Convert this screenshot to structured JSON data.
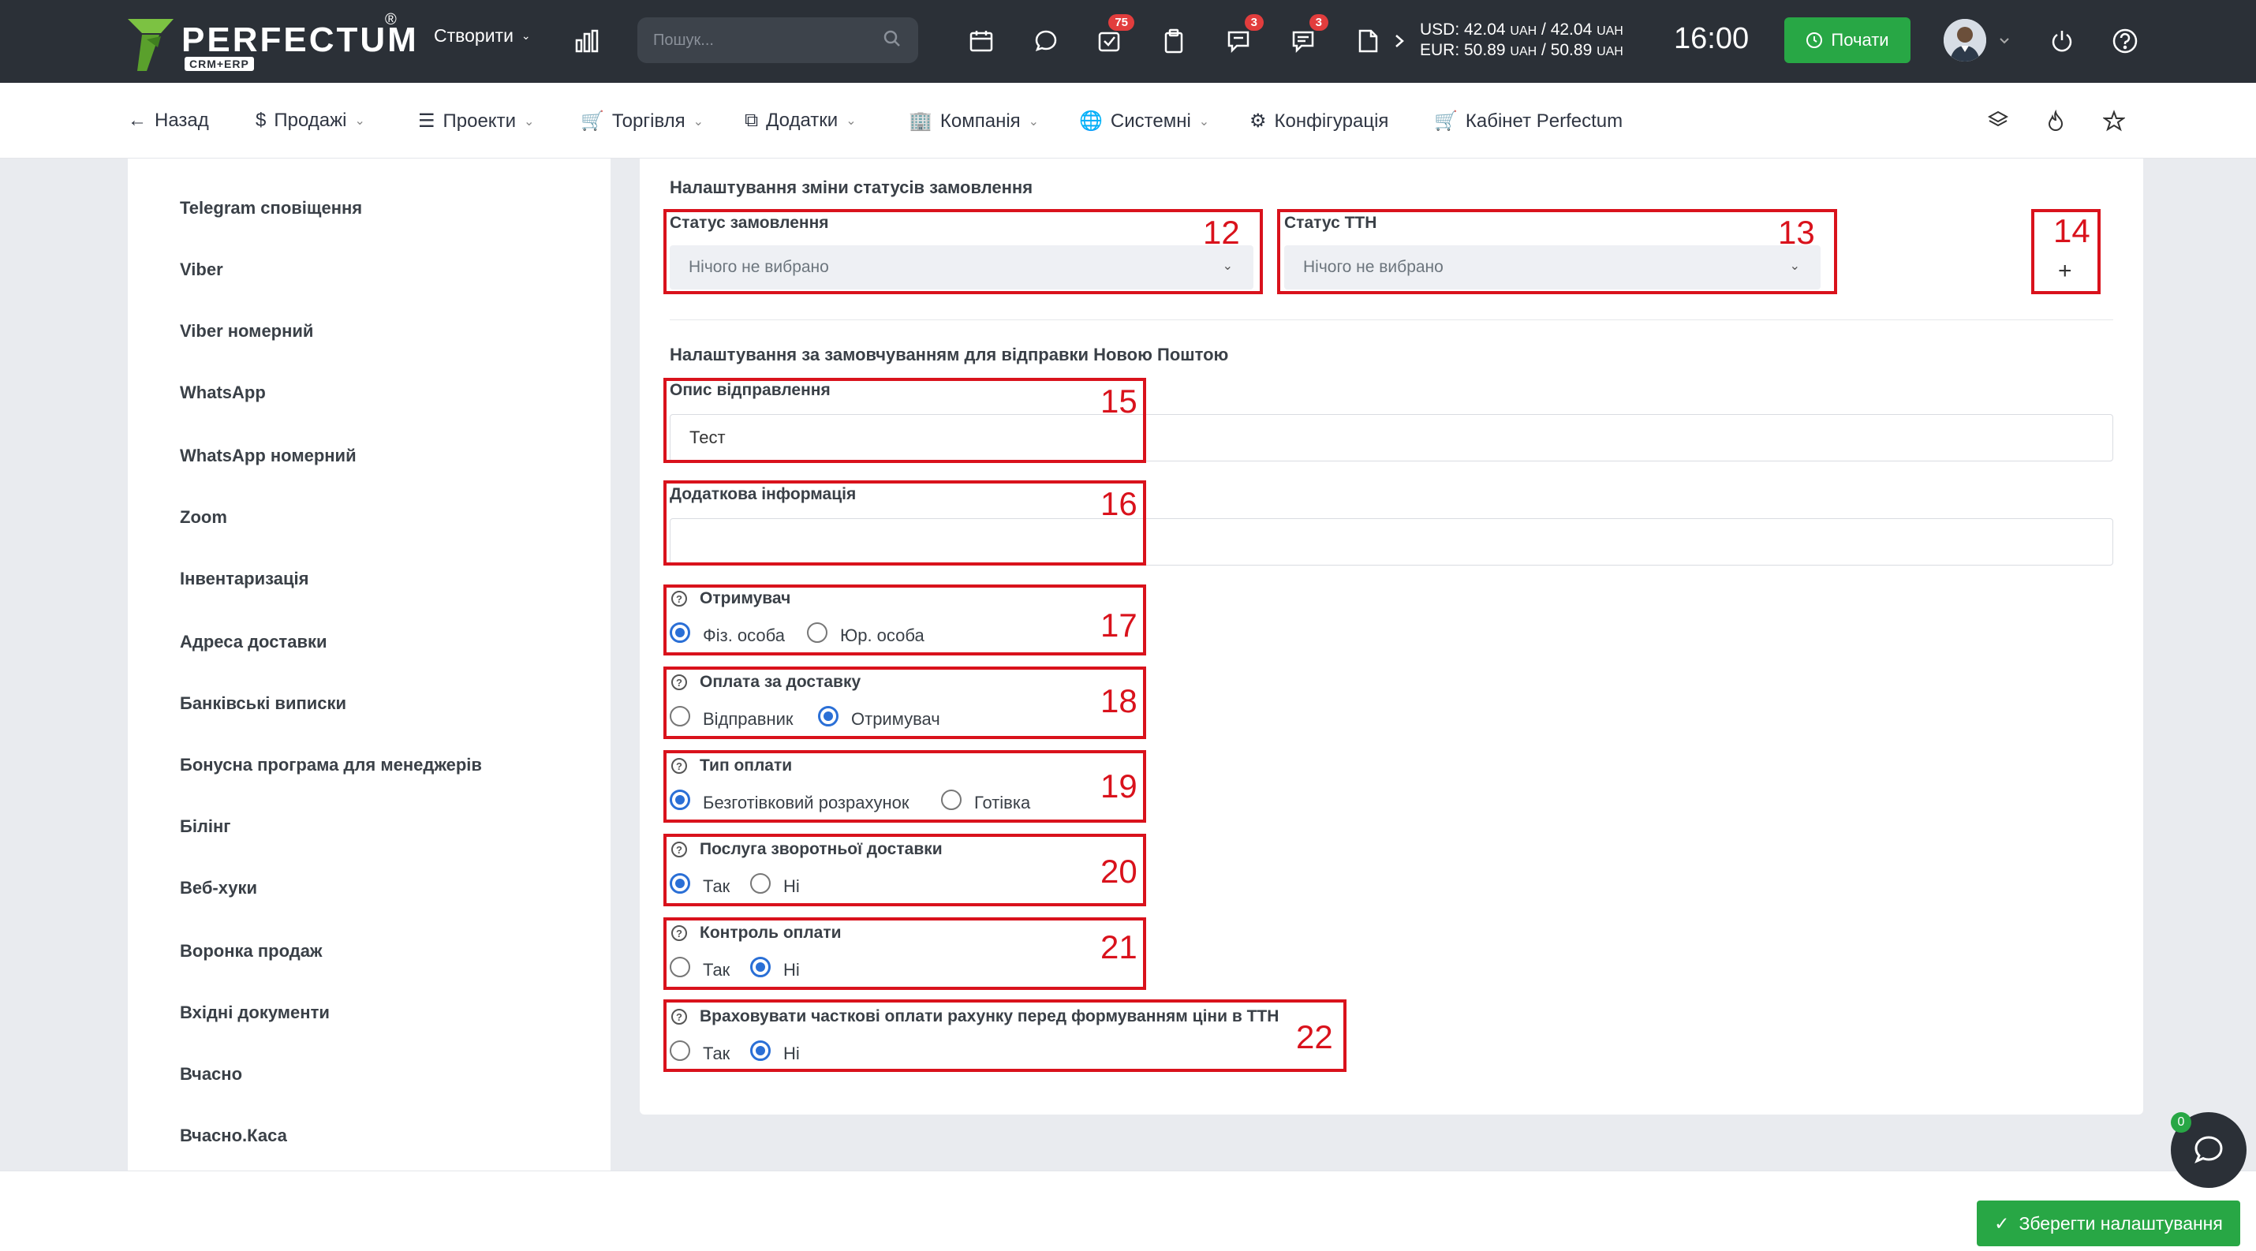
{
  "brand": {
    "name": "PERFECTUM",
    "sub": "CRM+ERP",
    "reg": "®"
  },
  "topbar": {
    "create_label": "Створити",
    "search_placeholder": "Пошук...",
    "badges": {
      "tasks": "75",
      "messages": "3",
      "chat": "3"
    },
    "rates": {
      "usd_line": "USD: 42.04",
      "usd_unit1": "UAH",
      "usd_sep": " / 42.04 ",
      "usd_unit2": "UAH",
      "eur_line": "EUR: 50.89",
      "eur_unit1": "UAH",
      "eur_sep": " / 50.89 ",
      "eur_unit2": "UAH"
    },
    "time": "16:00",
    "start_label": "Почати"
  },
  "nav": {
    "back": "Назад",
    "sales": "Продажі",
    "projects": "Проекти",
    "trade": "Торгівля",
    "addons": "Додатки",
    "company": "Компанія",
    "system": "Системні",
    "config": "Конфігурація",
    "cabinet": "Кабінет Perfectum"
  },
  "sidebar": {
    "items": [
      "Telegram сповіщення",
      "Viber",
      "Viber номерний",
      "WhatsApp",
      "WhatsApp номерний",
      "Zoom",
      "Інвентаризація",
      "Адреса доставки",
      "Банківські виписки",
      "Бонусна програма для менеджерів",
      "Білінг",
      "Веб-хуки",
      "Воронка продаж",
      "Вхідні документи",
      "Вчасно",
      "Вчасно.Каса"
    ]
  },
  "form": {
    "status_section": "Налаштування зміни статусів замовлення",
    "order_status_label": "Статус замовлення",
    "order_status_value": "Нічого не вибрано",
    "ttn_status_label": "Статус ТТН",
    "ttn_status_value": "Нічого не вибрано",
    "np_section": "Налаштування за замовчуванням для відправки Новою Поштою",
    "description_label": "Опис відправлення",
    "description_value": "Тест",
    "extra_info_label": "Додаткова інформація",
    "extra_info_value": "",
    "recipient": {
      "label": "Отримувач",
      "opt1": "Фіз. особа",
      "opt2": "Юр. особа",
      "selected": 1
    },
    "delivery_payment": {
      "label": "Оплата за доставку",
      "opt1": "Відправник",
      "opt2": "Отримувач",
      "selected": 2
    },
    "payment_type": {
      "label": "Тип оплати",
      "opt1": "Безготівковий розрахунок",
      "opt2": "Готівка",
      "selected": 1
    },
    "return_delivery": {
      "label": "Послуга зворотньої доставки",
      "opt1": "Так",
      "opt2": "Ні",
      "selected": 1
    },
    "payment_control": {
      "label": "Контроль оплати",
      "opt1": "Так",
      "opt2": "Ні",
      "selected": 2
    },
    "partial_payments": {
      "label": "Враховувати часткові оплати рахунку перед формуванням ціни в ТТН",
      "opt1": "Так",
      "opt2": "Ні",
      "selected": 2
    }
  },
  "annotations": [
    "12",
    "13",
    "14",
    "15",
    "16",
    "17",
    "18",
    "19",
    "20",
    "21",
    "22"
  ],
  "footer": {
    "save_label": "Зберегти налаштування",
    "chat_badge": "0"
  },
  "colors": {
    "topbar": "#2b3037",
    "accent_green": "#28a745",
    "annotation_red": "#d9121c",
    "radio_blue": "#2a6fd6"
  }
}
